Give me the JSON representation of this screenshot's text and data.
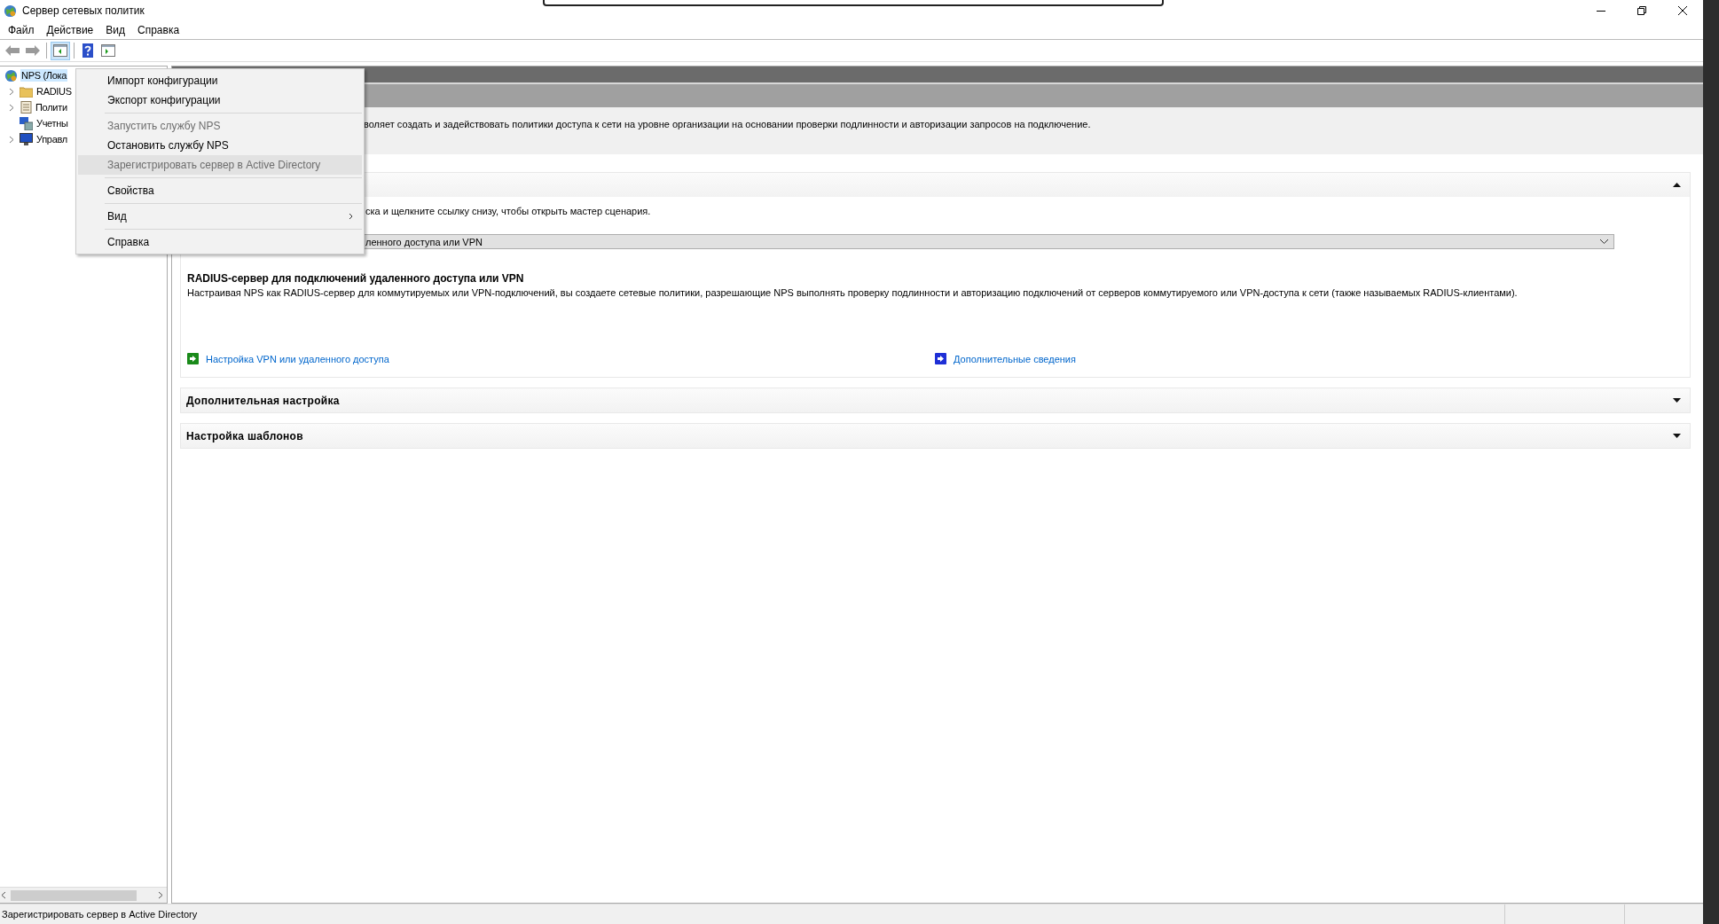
{
  "window": {
    "title": "Сервер сетевых политик"
  },
  "menu_bar": [
    {
      "label": "Файл"
    },
    {
      "label": "Действие"
    },
    {
      "label": "Вид"
    },
    {
      "label": "Справка"
    }
  ],
  "toolbar": [
    [
      {
        "kind": "back",
        "pressed": false
      },
      {
        "kind": "forward",
        "pressed": false
      }
    ],
    [
      {
        "kind": "tree",
        "pressed": true
      }
    ],
    [
      {
        "kind": "help",
        "pressed": false
      },
      {
        "kind": "pane",
        "pressed": false
      }
    ]
  ],
  "tree": [
    {
      "label": "NPS (Лока",
      "kind": "globe",
      "selected": true,
      "children": [
        {
          "label": "RADIUS",
          "kind": "folder",
          "selected": false,
          "collapsed": true
        },
        {
          "label": "Полити",
          "kind": "scroll",
          "selected": false,
          "collapsed": true
        },
        {
          "label": "Учетны",
          "kind": "computer",
          "selected": false,
          "collapsed": false
        },
        {
          "label": "Управл",
          "kind": "monitor",
          "selected": false,
          "collapsed": true
        }
      ]
    }
  ],
  "context_menu": {
    "groups": [
      [
        {
          "label": "Импорт конфигурации",
          "disabled": false,
          "highlighted": false,
          "submenu": false
        },
        {
          "label": "Экспорт конфигурации",
          "disabled": false,
          "highlighted": false,
          "submenu": false
        }
      ],
      [
        {
          "label": "Запустить службу NPS",
          "disabled": true,
          "highlighted": false,
          "submenu": false
        },
        {
          "label": "Остановить службу NPS",
          "disabled": false,
          "highlighted": false,
          "submenu": false
        },
        {
          "label": "Зарегистрировать сервер в Active Directory",
          "disabled": true,
          "highlighted": true,
          "submenu": false
        }
      ],
      [
        {
          "label": "Свойства",
          "disabled": false,
          "highlighted": false,
          "submenu": false
        }
      ],
      [
        {
          "label": "Вид",
          "disabled": false,
          "highlighted": false,
          "submenu": true
        }
      ],
      [
        {
          "label": "Справка",
          "disabled": false,
          "highlighted": false,
          "submenu": false
        }
      ]
    ]
  },
  "details": {
    "intro": "воляет создать и задействовать политики доступа к сети на уровне организации на основании проверки подлинности и авторизации запросов на подключение.",
    "sections": [
      {
        "expanded": true,
        "hint": "ска и щелкните ссылку снизу, чтобы открыть мастер сценария.",
        "dropdown": "ленного доступа или VPN",
        "heading": "RADIUS-сервер для подключений удаленного доступа или VPN",
        "description": "Настраивая NPS как RADIUS-сервер для коммутируемых или VPN-подключений, вы создаете сетевые политики, разрешающие NPS выполнять проверку подлинности и авторизацию подключений от серверов коммутируемого или VPN-доступа к сети (также называемых RADIUS-клиентами).",
        "links": [
          {
            "label": "Настройка VPN или удаленного доступа",
            "color": "#1a8a1a"
          },
          {
            "label": "Дополнительные сведения",
            "color": "#1e2fd6"
          }
        ]
      },
      {
        "title": "Дополнительная настройка",
        "expanded": false
      },
      {
        "title": "Настройка шаблонов",
        "expanded": false
      }
    ]
  },
  "status_bar": {
    "text": "Зарегистрировать сервер в Active Directory"
  }
}
